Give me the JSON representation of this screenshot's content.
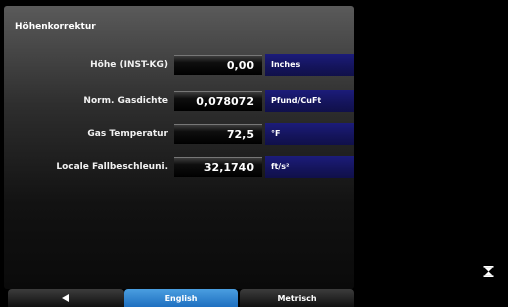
{
  "panel": {
    "title": "Höhenkorrektur"
  },
  "rows": [
    {
      "label": "Höhe (INST-KG)",
      "value": "0,00",
      "unit": "Inches"
    },
    {
      "label": "Norm. Gasdichte",
      "value": "0,078072",
      "unit": "Pfund/CuFt"
    },
    {
      "label": "Gas Temperatur",
      "value": "72,5",
      "unit": "°F"
    },
    {
      "label": "Locale Fallbeschleuni.",
      "value": "32,1740",
      "unit": "ft/s²"
    }
  ],
  "bottom_bar": {
    "back_icon": "left-arrow-icon",
    "english_label": "English",
    "metrisch_label": "Metrisch",
    "active_tab": "English"
  },
  "side_icon": "hourglass-icon",
  "colors": {
    "unit_background": "#16166a",
    "active_tab": "#2f86d6",
    "background": "#000000"
  }
}
